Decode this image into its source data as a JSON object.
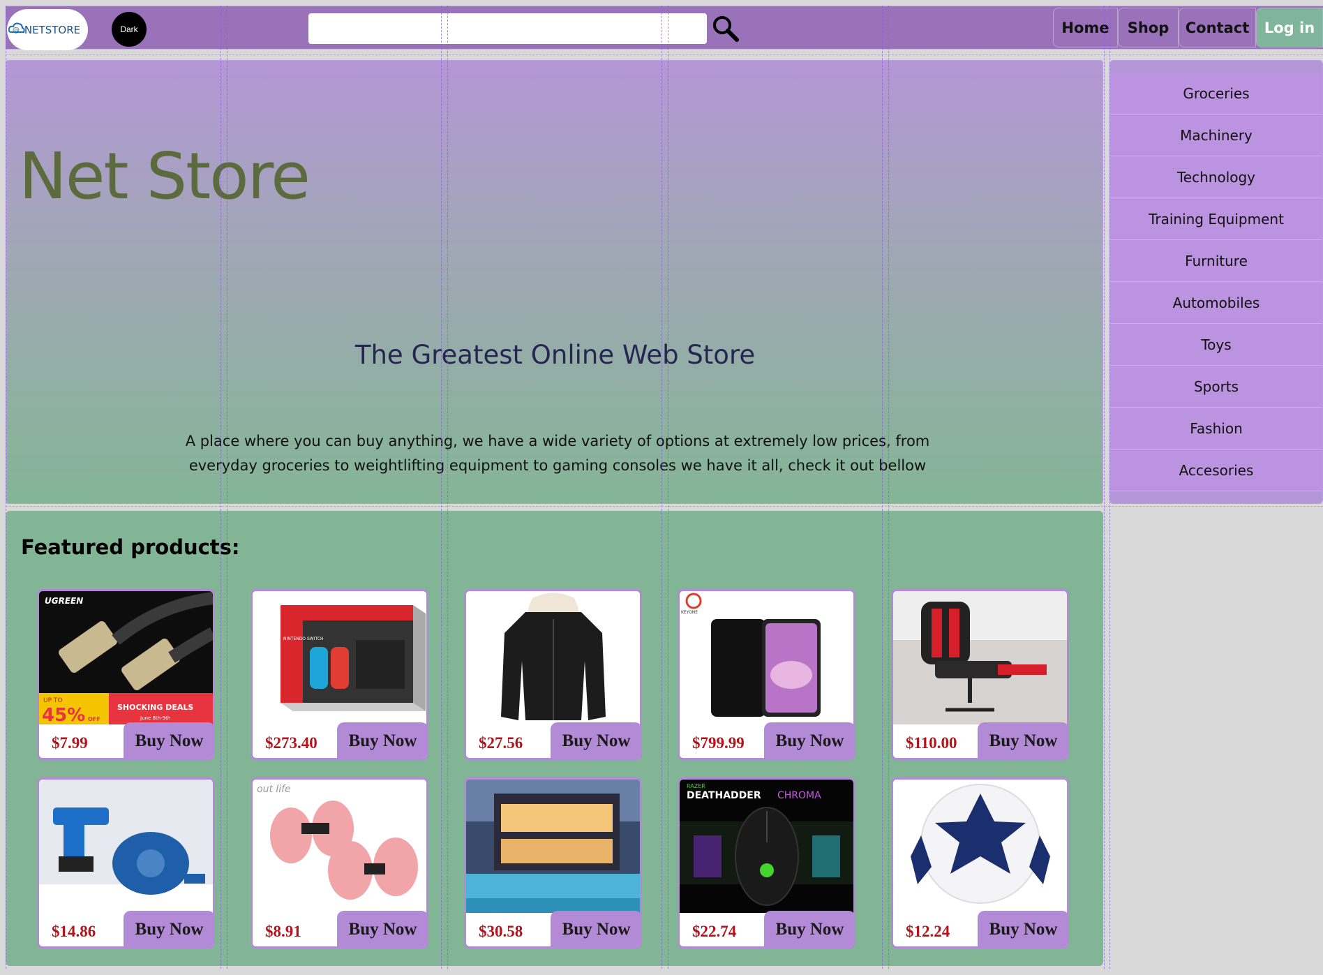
{
  "header": {
    "logo_text": "NETSTORE",
    "dark_toggle_label": "Dark",
    "search": {
      "value": "",
      "placeholder": ""
    },
    "nav": [
      {
        "label": "Home"
      },
      {
        "label": "Shop"
      },
      {
        "label": "Contact"
      },
      {
        "label": "Log in"
      }
    ],
    "colors": {
      "bar": "#9a72b9",
      "login": "#7fb59a"
    }
  },
  "hero": {
    "title": "Net Store",
    "subtitle": "The Greatest Online Web Store",
    "description": "A place where you can buy anything, we have a wide variety of options at extremely low prices, from everyday groceries to weightlifting equipment to gaming consoles we have it all, check it out bellow"
  },
  "categories": [
    "Groceries",
    "Machinery",
    "Technology",
    "Training Equipment",
    "Furniture",
    "Automobiles",
    "Toys",
    "Sports",
    "Fashion",
    "Accesories"
  ],
  "featured": {
    "title": "Featured products:",
    "buy_label": "Buy Now",
    "products": [
      {
        "image": "hdmi-cable",
        "image_text": [
          "UGREEN",
          "UP TO",
          "45%",
          "OFF",
          "SHOCKING DEALS",
          "June 8th-9th"
        ],
        "price": "$7.99"
      },
      {
        "image": "nintendo-switch",
        "image_text": [
          "NINTENDO SWITCH"
        ],
        "price": "$273.40"
      },
      {
        "image": "black-jacket",
        "image_text": [],
        "price": "$27.56"
      },
      {
        "image": "smartphone",
        "image_text": [
          "KEYONE"
        ],
        "price": "$799.99"
      },
      {
        "image": "gaming-chair",
        "image_text": [],
        "price": "$110.00"
      },
      {
        "image": "water-pump-drill",
        "image_text": [],
        "price": "$14.86"
      },
      {
        "image": "foam-dumbbells",
        "image_text": [
          "out life"
        ],
        "price": "$8.91"
      },
      {
        "image": "house-pool",
        "image_text": [],
        "price": "$30.58"
      },
      {
        "image": "gaming-mouse",
        "image_text": [
          "RAZER",
          "DEATHADDER",
          "CHROMA"
        ],
        "price": "$22.74"
      },
      {
        "image": "soccer-ball",
        "image_text": [],
        "price": "$12.24"
      }
    ]
  }
}
